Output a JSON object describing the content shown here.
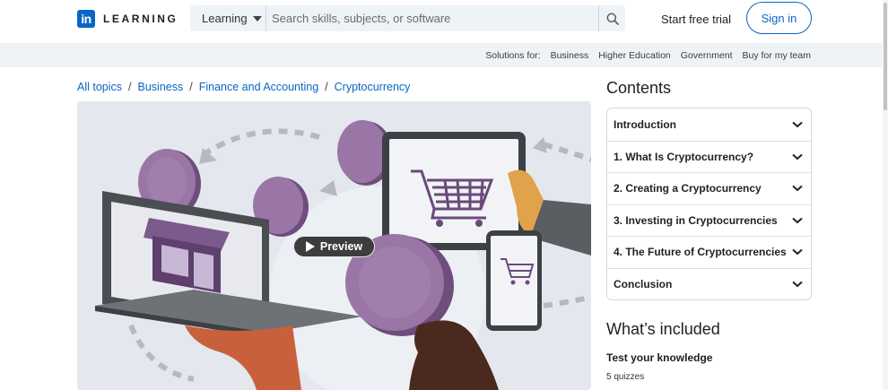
{
  "header": {
    "logo_mark": "in",
    "logo_text": "LEARNING",
    "search_category": "Learning",
    "search_placeholder": "Search skills, subjects, or software",
    "start_trial": "Start free trial",
    "sign_in": "Sign in"
  },
  "solutions": {
    "label": "Solutions for:",
    "links": [
      "Business",
      "Higher Education",
      "Government",
      "Buy for my team"
    ]
  },
  "breadcrumb": [
    "All topics",
    "Business",
    "Finance and Accounting",
    "Cryptocurrency"
  ],
  "preview": {
    "button_label": "Preview"
  },
  "contents": {
    "title": "Contents",
    "items": [
      "Introduction",
      "1. What Is Cryptocurrency?",
      "2. Creating a Cryptocurrency",
      "3. Investing in Cryptocurrencies",
      "4. The Future of Cryptocurrencies",
      "Conclusion"
    ]
  },
  "included": {
    "title": "What’s included",
    "item_title": "Test your knowledge",
    "item_detail": "5 quizzes"
  },
  "colors": {
    "accent": "#0a66c2",
    "coin": "#8f6a9a",
    "band": "#eef3f8"
  }
}
